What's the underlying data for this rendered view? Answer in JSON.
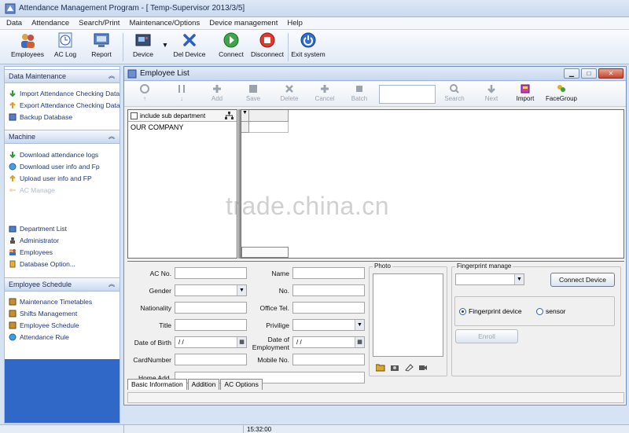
{
  "window": {
    "title": "Attendance Management Program - [ Temp-Supervisor 2013/3/5]"
  },
  "menu": [
    "Data",
    "Attendance",
    "Search/Print",
    "Maintenance/Options",
    "Device management",
    "Help"
  ],
  "toolbar": {
    "employees": "Employees",
    "aclog": "AC Log",
    "report": "Report",
    "device": "Device",
    "deldevice": "Del Device",
    "connect": "Connect",
    "disconnect": "Disconnect",
    "exit": "Exit system"
  },
  "sidebar": {
    "data_maintenance": {
      "title": "Data Maintenance",
      "items": [
        "Import Attendance Checking Data",
        "Export Attendance Checking Data",
        "Backup Database"
      ]
    },
    "machine": {
      "title": "Machine",
      "items": [
        "Download attendance logs",
        "Download user info and Fp",
        "Upload user info and FP",
        "AC Manage"
      ]
    },
    "maintenance": {
      "items": [
        "Department List",
        "Administrator",
        "Employees",
        "Database Option..."
      ]
    },
    "schedule": {
      "title": "Employee Schedule",
      "items": [
        "Maintenance Timetables",
        "Shifts Management",
        "Employee Schedule",
        "Attendance Rule"
      ]
    }
  },
  "employee_window": {
    "title": "Employee List",
    "toolbar": [
      "Add",
      "Save",
      "Delete",
      "Cancel",
      "Batch",
      "Search",
      "Next",
      "Import",
      "FaceGroup"
    ],
    "toolbar_labels_partial": [
      "↑",
      "↓"
    ]
  },
  "tree": {
    "include_sub": "include sub department",
    "root": "OUR COMPANY"
  },
  "form": {
    "ac_no": "AC No.",
    "gender": "Gender",
    "nationality": "Nationality",
    "title": "Title",
    "dob": "Date of Birth",
    "card": "CardNumber",
    "home": "Home Add.",
    "name": "Name",
    "no": "No.",
    "office": "Office Tel.",
    "privilege": "Privilige",
    "doe": "Date of Employment",
    "mobile": "Mobile No.",
    "date_placeholder": " /  /",
    "photo": "Photo",
    "fingerprint_manage": "Fingerprint manage",
    "connect_device": "Connect Device",
    "fp_device": "Fingerprint device",
    "sensor": "sensor",
    "enroll": "Enroll"
  },
  "tabs": [
    "Basic Information",
    "Addition",
    "AC Options"
  ],
  "status": {
    "time": "15:32:00"
  },
  "watermark": "trade.china.cn"
}
